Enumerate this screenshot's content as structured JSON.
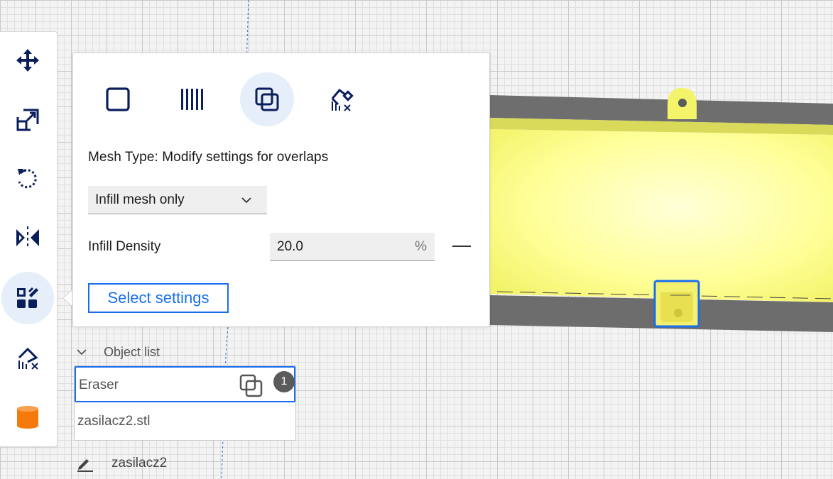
{
  "toolbar": {
    "tools": [
      {
        "name": "move-tool",
        "icon": "move-icon"
      },
      {
        "name": "scale-tool",
        "icon": "scale-icon"
      },
      {
        "name": "rotate-tool",
        "icon": "rotate-icon"
      },
      {
        "name": "mirror-tool",
        "icon": "mirror-icon"
      },
      {
        "name": "per-model-settings-tool",
        "icon": "per-model-settings-icon",
        "active": true
      },
      {
        "name": "support-blocker-tool",
        "icon": "support-blocker-icon"
      },
      {
        "name": "material-spool-tool",
        "icon": "spool-icon"
      }
    ]
  },
  "panel": {
    "mesh_types": [
      {
        "name": "normal-model",
        "icon": "square-outline-icon"
      },
      {
        "name": "print-as-support",
        "icon": "vertical-bars-icon"
      },
      {
        "name": "modify-overlaps",
        "icon": "overlap-squares-icon",
        "active": true
      },
      {
        "name": "dont-support-overlaps",
        "icon": "support-blocker-icon"
      }
    ],
    "mesh_type_label": "Mesh Type: Modify settings for overlaps",
    "mesh_select_value": "Infill mesh only",
    "density_label": "Infill Density",
    "density_value": "20.0",
    "density_unit": "%",
    "select_settings_label": "Select settings"
  },
  "object_list": {
    "title": "Object list",
    "items": [
      {
        "name": "Eraser",
        "selected": true,
        "badge": "1"
      },
      {
        "name": "zasilacz2.stl",
        "selected": false
      }
    ]
  },
  "job": {
    "name": "zasilacz2"
  },
  "colors": {
    "accent": "#196ef0",
    "icon_dark": "#0a1e5c",
    "model_yellow": "#ffff80",
    "model_shadow": "#6d6d6d",
    "spool_orange": "#f47b0b"
  }
}
